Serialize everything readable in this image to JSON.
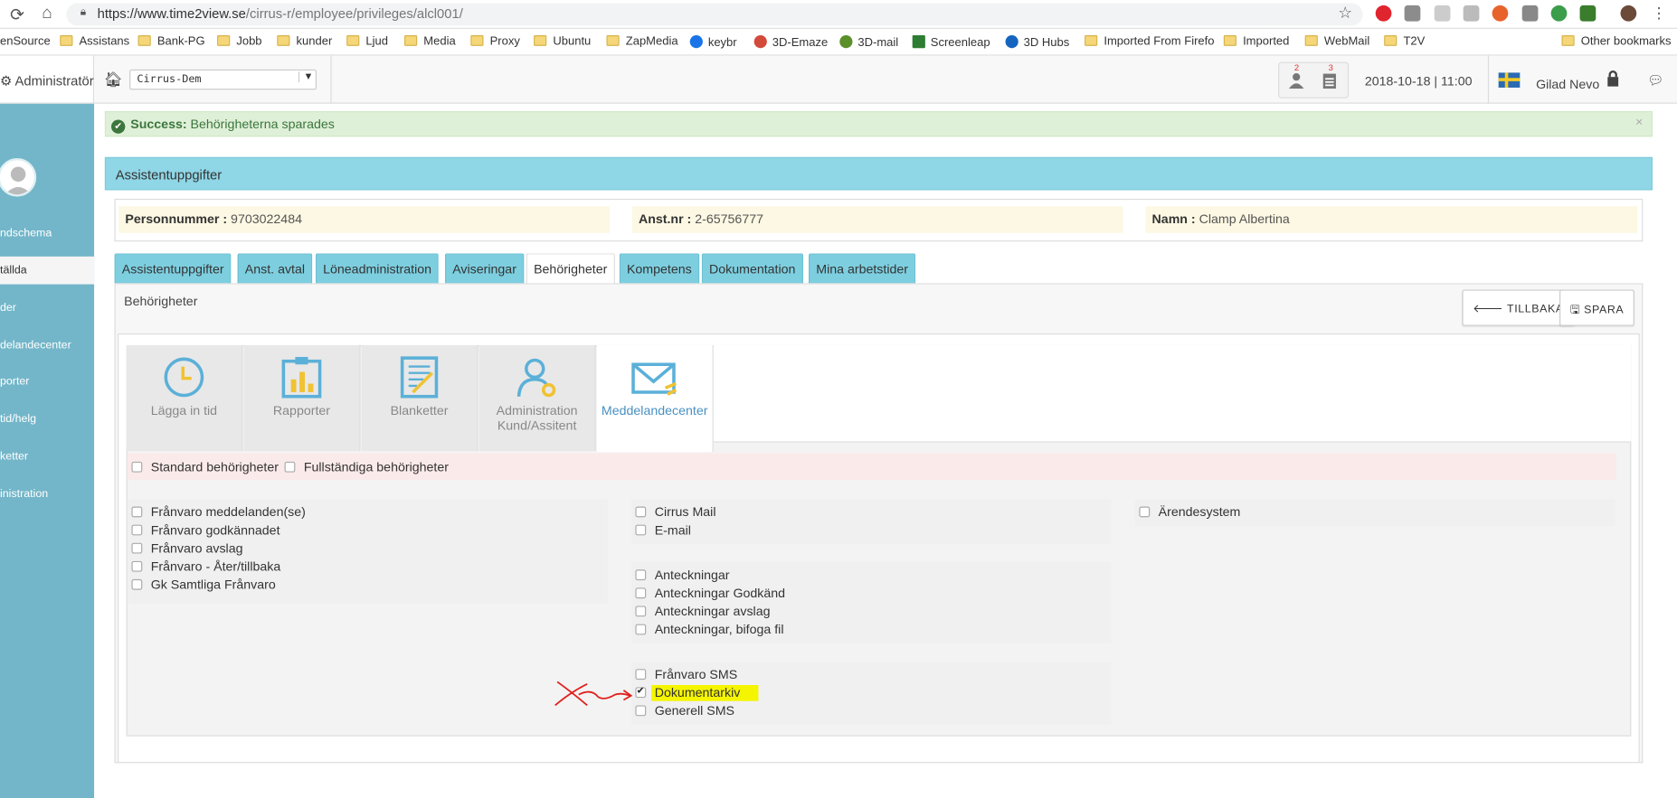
{
  "browser": {
    "url_host": "https://www.time2view.se",
    "url_path": "/cirrus-r/employee/privileges/alcl001/",
    "bookmarks": [
      "enSource",
      "Assistans",
      "Bank-PG",
      "Jobb",
      "kunder",
      "Ljud",
      "Media",
      "Proxy",
      "Ubuntu",
      "ZapMedia",
      "keybr",
      "3D-Emaze",
      "3D-mail",
      "Screenleap",
      "3D Hubs",
      "Imported From Firefo",
      "Imported",
      "WebMail",
      "T2V",
      "Other bookmarks"
    ]
  },
  "topbar": {
    "role": "Administratör",
    "client_select": "Cirrus-Dem",
    "badge_users": "2",
    "badge_tasks": "3",
    "datetime": "2018-10-18 | 11:00",
    "user": "Gilad Nevo"
  },
  "sidebar": {
    "items": [
      "ndschema",
      "tällda",
      "der",
      "delandecenter",
      "porter",
      "tid/helg",
      "ketter",
      "inistration"
    ]
  },
  "alert": {
    "strong": "Success:",
    "text": " Behörigheterna sparades",
    "close": "×"
  },
  "panel": {
    "title": "Assistentuppgifter",
    "personnummer_label": "Personnummer :",
    "personnummer": " 9703022484",
    "anstnr_label": "Anst.nr :",
    "anstnr": " 2-65756777",
    "namn_label": "Namn :",
    "namn": " Clamp Albertina"
  },
  "tabs": [
    "Assistentuppgifter",
    "Anst. avtal",
    "Löneadministration",
    "Aviseringar",
    "Behörigheter",
    "Kompetens",
    "Dokumentation",
    "Mina arbetstider"
  ],
  "section": {
    "title": "Behörigheter",
    "back": "TILLBAKA",
    "save": "SPARA"
  },
  "tiles": [
    {
      "label": "Lägga in tid",
      "icon": "clock-icon"
    },
    {
      "label": "Rapporter",
      "icon": "clipboard-chart-icon"
    },
    {
      "label": "Blanketter",
      "icon": "form-icon"
    },
    {
      "label": "Administration",
      "label2": "Kund/Assitent",
      "icon": "user-gear-icon"
    },
    {
      "label": "Meddelandecenter",
      "icon": "envelope-icon"
    }
  ],
  "presets": {
    "standard": "Standard behörigheter",
    "full": "Fullständiga behörigheter"
  },
  "col1": [
    "Frånvaro meddelanden(se)",
    "Frånvaro godkännadet",
    "Frånvaro avslag",
    "Frånvaro - Åter/tillbaka",
    "Gk Samtliga Frånvaro"
  ],
  "col2a": [
    "Cirrus Mail",
    "E-mail"
  ],
  "col2b": [
    "Anteckningar",
    "Anteckningar Godkänd",
    "Anteckningar avslag",
    "Anteckningar, bifoga fil"
  ],
  "col2c": [
    {
      "label": "Frånvaro SMS",
      "checked": false
    },
    {
      "label": "Dokumentarkiv",
      "checked": true
    },
    {
      "label": "Generell SMS",
      "checked": false
    }
  ],
  "col3": [
    "Ärendesystem"
  ],
  "colors": {
    "accent": "#8fd6e6",
    "sidebar": "#73b6c9",
    "highlight": "#f5f500",
    "annotation": "#e0201c"
  }
}
